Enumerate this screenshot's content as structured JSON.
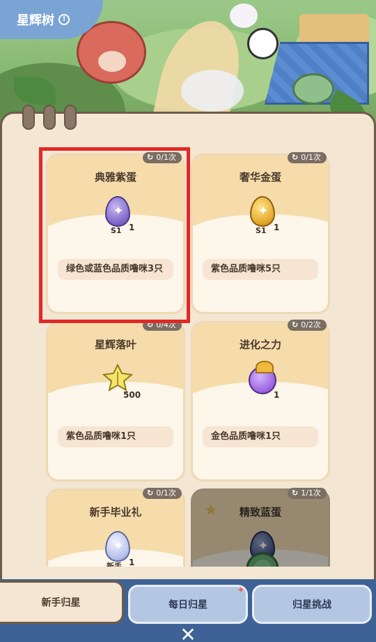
{
  "header": {
    "title": "星辉树",
    "info_icon": "info-icon"
  },
  "cards": [
    {
      "name": "典雅紫蛋",
      "counter": "0/1次",
      "reward_icon": "purple-egg-icon",
      "reward_badge": "S1",
      "reward_qty": "1",
      "requirement": "绿色或蓝色品质噜咪3只",
      "selected": true,
      "locked": false
    },
    {
      "name": "奢华金蛋",
      "counter": "0/1次",
      "reward_icon": "gold-egg-icon",
      "reward_badge": "S1",
      "reward_qty": "1",
      "requirement": "紫色品质噜咪5只",
      "selected": false,
      "locked": false
    },
    {
      "name": "星辉落叶",
      "counter": "0/4次",
      "reward_icon": "starlight-leaf-icon",
      "reward_qty": "500",
      "requirement": "紫色品质噜咪1只",
      "selected": false,
      "locked": false
    },
    {
      "name": "进化之力",
      "counter": "0/2次",
      "reward_icon": "evolution-fruit-icon",
      "reward_qty": "1",
      "requirement": "金色品质噜咪1只",
      "selected": false,
      "locked": false
    },
    {
      "name": "新手毕业礼",
      "counter": "0/1次",
      "reward_icon": "novice-egg-icon",
      "reward_badge": "新手",
      "reward_qty": "1",
      "selected": false,
      "locked": false
    },
    {
      "name": "精致蓝蛋",
      "counter": "1/1次",
      "reward_icon": "blue-egg-icon",
      "selected": false,
      "locked": true
    }
  ],
  "tabs": [
    {
      "label": "新手归星",
      "active": true
    },
    {
      "label": "每日归星",
      "active": false,
      "has_notice": true
    },
    {
      "label": "归星挑战",
      "active": false
    }
  ],
  "colors": {
    "selection": "#e32727",
    "panel": "#f3e6d2",
    "tabbar": "#3f6296"
  }
}
